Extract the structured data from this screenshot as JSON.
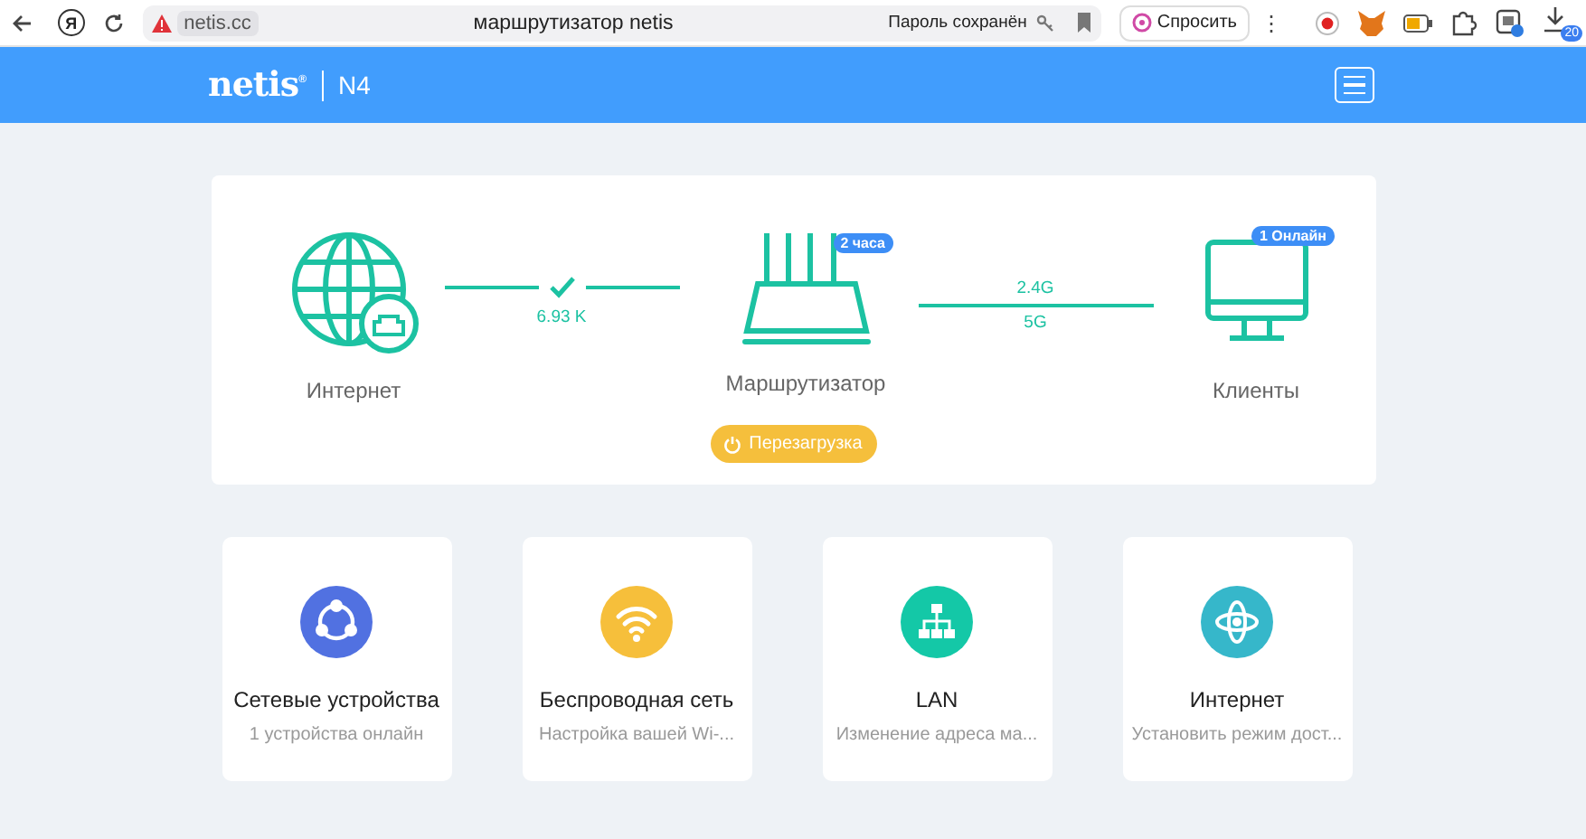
{
  "browser": {
    "profile_letter": "Я",
    "address": "netis.cc",
    "page_title": "маршрутизатор netis",
    "password_note": "Пароль сохранён",
    "ask_button": "Спросить",
    "more": "⋮",
    "download_count": "20"
  },
  "header": {
    "logo": "netis",
    "logo_mark": "®",
    "model": "N4"
  },
  "status": {
    "internet": {
      "label": "Интернет",
      "connected": true,
      "rate": "6.93 K"
    },
    "router": {
      "label": "Маршрутизатор",
      "badge": "2 часа"
    },
    "bands": [
      "2.4G",
      "5G"
    ],
    "clients": {
      "label": "Клиенты",
      "badge": "1 Онлайн"
    },
    "reboot": "Перезагрузка"
  },
  "tiles": [
    {
      "kind": "devices",
      "color": "#5171e1",
      "title": "Сетевые устройства",
      "subtitle": "1 устройства онлайн"
    },
    {
      "kind": "wireless",
      "color": "#f6bf3b",
      "title": "Беспроводная сеть",
      "subtitle": "Настройка вашей Wi-..."
    },
    {
      "kind": "lan",
      "color": "#14c8a7",
      "title": "LAN",
      "subtitle": "Изменение адреса ма..."
    },
    {
      "kind": "internet",
      "color": "#36b7ca",
      "title": "Интернет",
      "subtitle": "Установить режим дост..."
    }
  ]
}
